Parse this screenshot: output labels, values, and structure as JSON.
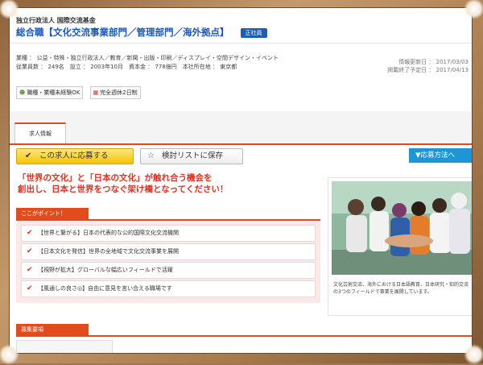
{
  "header": {
    "company": "独立行政法人 国際交流基金",
    "title": "総合職【文化交流事業部門／管理部門／海外拠点】",
    "employment_badge": "正社員",
    "industry": "業種 ： 公益・特殊・独立行政法人／教育／新聞・出版・印刷／ディスプレイ・空間デザイン・イベント",
    "company_info": "従業員数 ： 249名　設立 ： 2003年10月　資本金 ： 778億円　本社所在地 ： 東京都",
    "posted_date": "情報更新日 ： 2017/03/03",
    "end_date": "掲載終了予定日 ： 2017/04/13"
  },
  "tags": [
    {
      "icon": "person-icon",
      "label": "職種・業種未経験OK"
    },
    {
      "icon": "calendar-icon",
      "label": "完全週休2日制"
    }
  ],
  "tabs": [
    {
      "label": "求人情報"
    }
  ],
  "actions": {
    "apply_label": "この求人に応募する",
    "save_label": "検討リストに保存",
    "method_label": "▼応募方法へ"
  },
  "catch_copy": {
    "line1": "「世界の文化」と「日本の文化」が触れ合う機会を",
    "line2": "創出し、日本と世界をつなぐ架け橋となってください！"
  },
  "points": {
    "label": "ここがポイント！",
    "items": [
      "【世界と繋がる】日本の代表的な公的国際文化交流機関",
      "【日本文化を発信】世界の全地域で文化交流事業を展開",
      "【視野が拡大】グローバルな幅広いフィールドで活躍",
      "【風通しの良さ◎】自由に意見を言い合える職場です"
    ]
  },
  "photo": {
    "caption": "文化芸術交流、海外における日本語教育、日本研究・知的交流の3つのフィールドで事業を展開しています。"
  },
  "recruit": {
    "label": "募集要項"
  },
  "colors": {
    "accent": "#e34a1c",
    "title_blue": "#1b58b8",
    "apply_yellow": "#f6c400",
    "method_blue": "#1e96d6"
  }
}
